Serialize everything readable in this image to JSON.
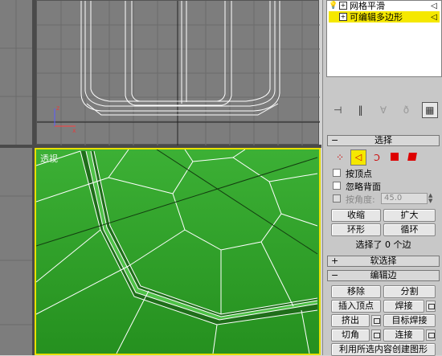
{
  "viewports": {
    "perspective_label": "透视"
  },
  "modifier_stack": {
    "items": [
      {
        "label": "网格平滑",
        "selected": false
      },
      {
        "label": "可编辑多边形",
        "selected": true
      }
    ]
  },
  "selection": {
    "title": "选择",
    "ignore_back_label": "按顶点",
    "ignore_backfacing_label": "忽略背面",
    "by_angle_label": "按角度:",
    "angle_value": "45.0",
    "shrink_label": "收缩",
    "grow_label": "扩大",
    "ring_label": "环形",
    "loop_label": "循环",
    "status": "选择了 0 个边"
  },
  "soft_selection": {
    "title": "软选择"
  },
  "edit_edges": {
    "title": "编辑边",
    "remove_label": "移除",
    "split_label": "分割",
    "insert_vertex_label": "插入顶点",
    "weld_label": "焊接",
    "extrude_label": "挤出",
    "target_weld_label": "目标焊接",
    "chamfer_label": "切角",
    "connect_label": "连接",
    "create_shape_label": "利用所选内容创建图形"
  },
  "colors": {
    "selected_highlight": "#f5e800",
    "viewport_green": "#2fa82a",
    "active_border": "#e8e000"
  }
}
